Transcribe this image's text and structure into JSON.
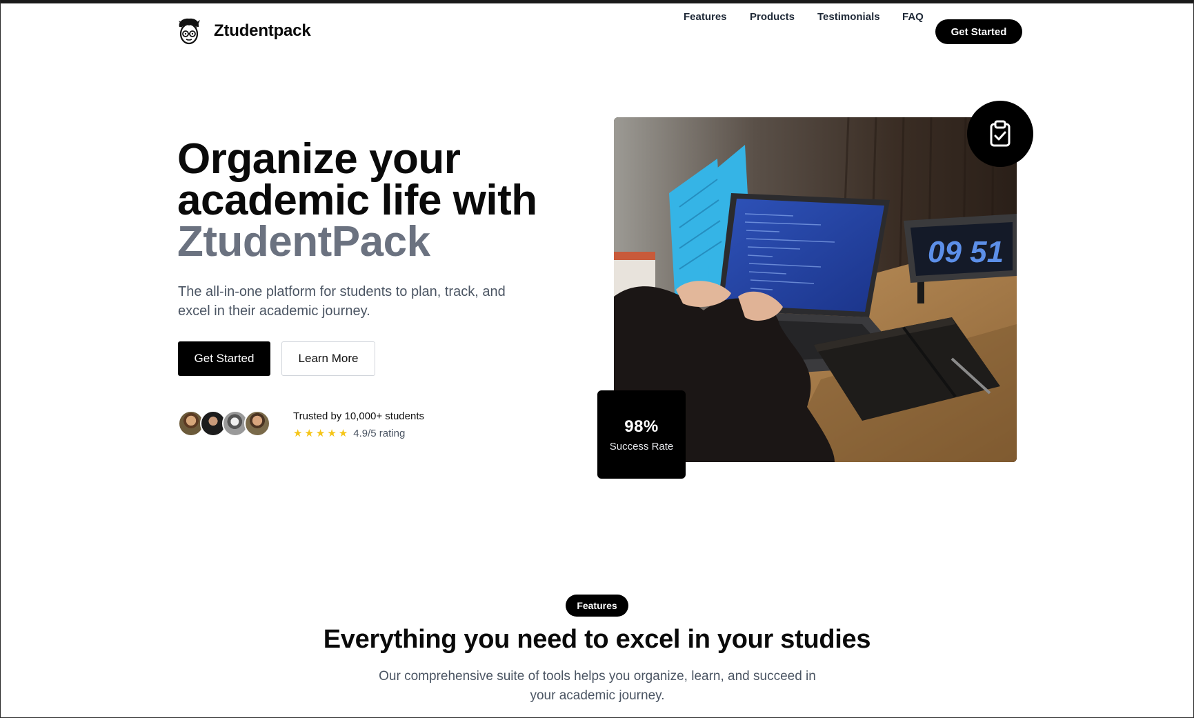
{
  "nav": {
    "brand": "Ztudentpack",
    "links": [
      "Features",
      "Products",
      "Testimonials",
      "FAQ"
    ],
    "cta": "Get Started"
  },
  "hero": {
    "title_line1": "Organize your",
    "title_line2": "academic life with",
    "title_accent": "ZtudentPack",
    "subtitle": "The all-in-one platform for students to plan, track, and excel in their academic journey.",
    "primary_button": "Get Started",
    "secondary_button": "Learn More",
    "trust_text": "Trusted by 10,000+ students",
    "stars": "★★★★★",
    "rating_value": 4.9,
    "rating_text": "4.9/5 rating",
    "stat_value": "98%",
    "stat_label": "Success Rate",
    "image_icon": "clipboard-check-icon",
    "clock_display": "09 51"
  },
  "features": {
    "pill": "Features",
    "title": "Everything you need to excel in your studies",
    "subtitle": "Our comprehensive suite of tools helps you organize, learn, and succeed in your academic journey."
  },
  "colors": {
    "primary": "#000000",
    "accent_text": "#6b7280",
    "muted_text": "#4b5563",
    "star": "#f5c518"
  }
}
